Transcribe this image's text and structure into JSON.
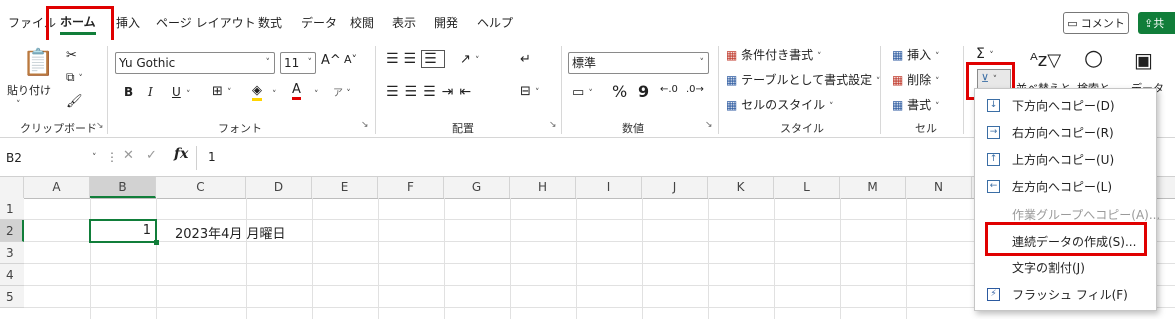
{
  "menubar": {
    "tabs": [
      "ファイル",
      "ホーム",
      "挿入",
      "ページ レイアウト",
      "数式",
      "データ",
      "校閲",
      "表示",
      "開発",
      "ヘルプ"
    ],
    "comment_label": "コメント",
    "share_label": "共"
  },
  "ribbon": {
    "clipboard": {
      "paste": "貼り付け",
      "label": "クリップボード"
    },
    "font": {
      "name": "Yu Gothic",
      "size": "11",
      "grow": "A^",
      "shrink": "A˅",
      "bold": "B",
      "italic": "I",
      "underline": "U",
      "label": "フォント"
    },
    "alignment": {
      "label": "配置"
    },
    "number": {
      "format": "標準",
      "percent": "%",
      "comma": "9",
      "label": "数値"
    },
    "styles": {
      "conditional": "条件付き書式",
      "table": "テーブルとして書式設定",
      "cell": "セルのスタイル",
      "label": "スタイル"
    },
    "cells": {
      "insert": "挿入",
      "delete": "削除",
      "format": "書式",
      "label": "セル"
    },
    "editing": {
      "sort": "並べ替えと",
      "find": "検索と",
      "data": "データ"
    }
  },
  "formula": {
    "namebox": "B2",
    "fx": "fx",
    "value": "1"
  },
  "grid": {
    "columns": [
      "A",
      "B",
      "C",
      "D",
      "E",
      "F",
      "G",
      "H",
      "I",
      "J",
      "K",
      "L",
      "M",
      "N"
    ],
    "rows": [
      "1",
      "2",
      "3",
      "4",
      "5"
    ],
    "b2": "1",
    "c2": "2023年4月 月曜日"
  },
  "fill_menu": {
    "items": [
      {
        "label": "下方向へコピー(D)",
        "icon": "arrow-down",
        "disabled": false
      },
      {
        "label": "右方向へコピー(R)",
        "icon": "arrow-right",
        "disabled": false
      },
      {
        "label": "上方向へコピー(U)",
        "icon": "arrow-up",
        "disabled": false
      },
      {
        "label": "左方向へコピー(L)",
        "icon": "arrow-left",
        "disabled": false
      },
      {
        "label": "作業グループへコピー(A)...",
        "icon": "",
        "disabled": true
      },
      {
        "label": "連続データの作成(S)...",
        "icon": "",
        "disabled": false
      },
      {
        "label": "文字の割付(J)",
        "icon": "",
        "disabled": false
      },
      {
        "label": "フラッシュ フィル(F)",
        "icon": "flash-fill",
        "disabled": false
      }
    ]
  },
  "colors": {
    "accent": "#117e3a",
    "highlight": "#e00000"
  }
}
